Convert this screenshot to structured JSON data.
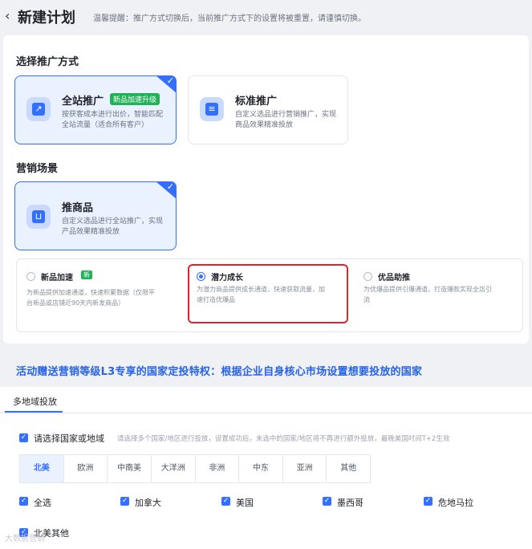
{
  "header": {
    "back": "‹",
    "title": "新建计划",
    "tip": "温馨提醒：推广方式切换后，当前推广方式下的设置将被重置，请谨慎切换。"
  },
  "promo": {
    "section_title": "选择推广方式",
    "cards": [
      {
        "title": "全站推广",
        "badge": "新品加速升级",
        "desc1": "按获客成本进行出价，智能匹配",
        "desc2": "全站流量（适合所有客户）",
        "selected": true
      },
      {
        "title": "标准推广",
        "desc1": "自定义选品进行营销推广，实现",
        "desc2": "商品效果精准投放",
        "selected": false
      }
    ]
  },
  "scene": {
    "section_title": "营销场景",
    "card": {
      "title": "推商品",
      "desc1": "自定义选品进行全站推广，实现",
      "desc2": "产品效果精准投放",
      "selected": true
    }
  },
  "options": [
    {
      "title": "新品加速",
      "badge": "新",
      "desc1": "为新品提供加速通道，快速积累数据（仅限平",
      "desc2": "台新品或店铺近90天内新发商品）",
      "selected": false
    },
    {
      "title": "潜力成长",
      "desc1": "为潜力商品提供成长通道，快速获取流量，加",
      "desc2": "速打造优爆品",
      "selected": true
    },
    {
      "title": "优品助推",
      "desc1": "为优爆品提供引爆通道，打造爆款实现全店引",
      "desc2": "流",
      "selected": false
    }
  ],
  "banner": "活动赠送营销等级L3专享的国家定投特权：根据企业自身核心市场设置想要投放的国家",
  "region": {
    "tab": "多地域投放",
    "select_label": "请选择国家或地域",
    "hint": "请选择多个国家/地区进行投放，设置成功后，未选中的国家/地区将不再进行额外投放，最晚美国时间T+2生效",
    "tabs": [
      "北美",
      "欧洲",
      "中南美",
      "大洋洲",
      "非洲",
      "中东",
      "亚洲",
      "其他"
    ],
    "active_tab": "北美",
    "countries": [
      "全选",
      "加拿大",
      "美国",
      "墨西哥",
      "危地马拉"
    ],
    "more": "北美其他"
  },
  "watermark": "大数据营销",
  "colors": {
    "accent": "#3470ff",
    "badge_green": "#1fb356",
    "highlight_red": "#d9262c",
    "banner_blue": "#2563eb"
  }
}
